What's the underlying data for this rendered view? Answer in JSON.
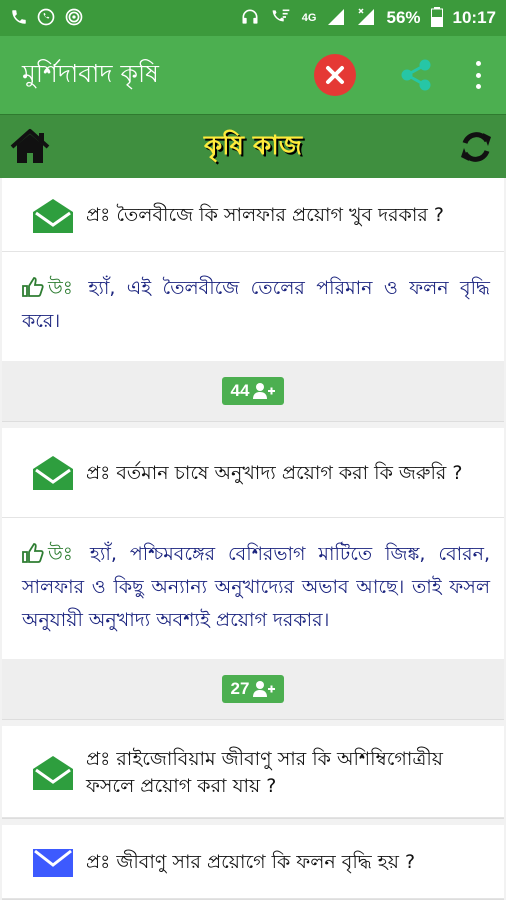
{
  "status": {
    "network": "4G",
    "battery": "56%",
    "time": "10:17"
  },
  "appbar": {
    "title": "মুর্শিদাবাদ কৃষি"
  },
  "subbar": {
    "title": "কৃষি কাজ"
  },
  "cards": [
    {
      "question": "প্রঃ তৈলবীজে কি সালফার প্রয়োগ খুব দরকার ?",
      "answer_prefix": "উঃ",
      "answer": "হ্যাঁ, এই তৈলবীজে তেলের পরিমান ও ফলন বৃদ্ধি করে।",
      "count": "44"
    },
    {
      "question": "প্রঃ বর্তমান চাষে অনুখাদ্য প্রয়োগ করা কি জরুরি ?",
      "answer_prefix": "উঃ",
      "answer": "হ্যাঁ, পশ্চিমবঙ্গের বেশিরভাগ মাটিতে জিঙ্ক, বোরন, সালফার ও কিছু অন্যান্য অনুখাদ্যের অভাব আছে। তাই ফসল অনুযায়ী অনুখাদ্য অবশ্যই প্রয়োগ দরকার।",
      "count": "27"
    },
    {
      "question": "প্রঃ রাইজোবিয়াম জীবাণু সার কি অশিম্বিগোত্রীয় ফসলে প্রয়োগ করা যায় ?"
    },
    {
      "question": "প্রঃ জীবাণু সার প্রয়োগে কি ফলন বৃদ্ধি হয় ?"
    }
  ],
  "colors": {
    "appbar": "#4caf50",
    "subbar": "#3f8f3f",
    "title_yellow": "#ffeb3b",
    "answer_blue": "#1a237e",
    "close_red": "#e53935",
    "share_teal": "#26c6a6"
  }
}
